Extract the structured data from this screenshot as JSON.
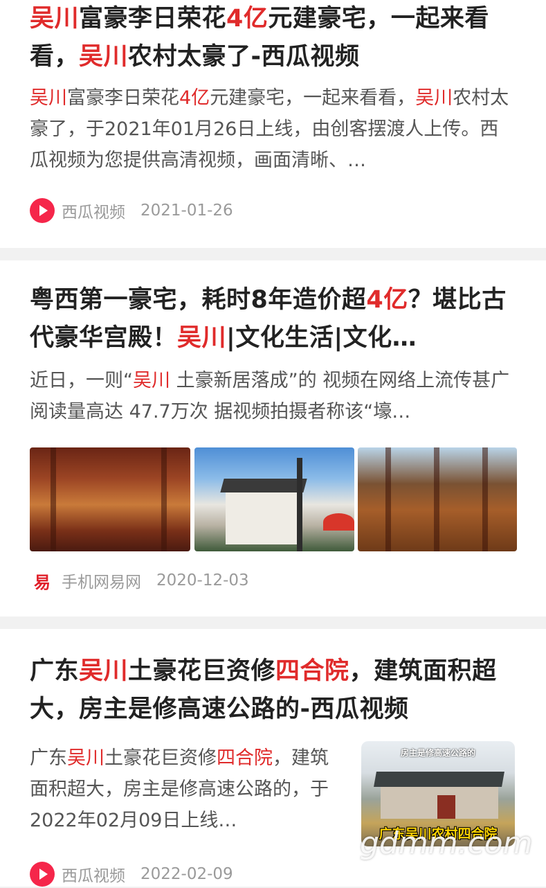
{
  "results": [
    {
      "title_segments": [
        {
          "text": "吴川",
          "hl": true
        },
        {
          "text": "富豪李日荣花",
          "hl": false
        },
        {
          "text": "4亿",
          "hl": true
        },
        {
          "text": "元建豪宅，一起来看看，",
          "hl": false
        },
        {
          "text": "吴川",
          "hl": true
        },
        {
          "text": "农村太豪了-西瓜视频",
          "hl": false
        }
      ],
      "desc_segments": [
        {
          "text": "吴川",
          "hl": true
        },
        {
          "text": "富豪李日荣花",
          "hl": false
        },
        {
          "text": "4亿",
          "hl": true
        },
        {
          "text": "元建豪宅，一起来看看，",
          "hl": false
        },
        {
          "text": "吴川",
          "hl": true
        },
        {
          "text": "农村太豪了，于2021年01月26日上线，由创客摆渡人上传。西瓜视频为您提供高清视频，画面清晰、…",
          "hl": false
        }
      ],
      "source": "西瓜视频",
      "source_icon": "xigua-video-icon",
      "date": "2021-01-26"
    },
    {
      "title_segments": [
        {
          "text": "粤西第一豪宅，耗时8年造价超",
          "hl": false
        },
        {
          "text": "4亿",
          "hl": true
        },
        {
          "text": "？堪比古代豪华宫殿！",
          "hl": false
        },
        {
          "text": "吴川",
          "hl": true
        },
        {
          "text": "|文化生活|文化…",
          "hl": false
        }
      ],
      "desc_segments": [
        {
          "text": "近日，一则“",
          "hl": false
        },
        {
          "text": "吴川",
          "hl": true
        },
        {
          "text": " 土豪新居落成”的 视频在网络上流传甚广 阅读量高达 47.7万次 据视频拍摄者称该“壕…",
          "hl": false
        }
      ],
      "source": "手机网易网",
      "source_icon": "netease-icon",
      "date": "2020-12-03"
    },
    {
      "title_segments": [
        {
          "text": "广东",
          "hl": false
        },
        {
          "text": "吴川",
          "hl": true
        },
        {
          "text": "土豪花巨资修",
          "hl": false
        },
        {
          "text": "四合院",
          "hl": true
        },
        {
          "text": "，建筑面积超大，房主是修高速公路的-西瓜视频",
          "hl": false
        }
      ],
      "desc_segments": [
        {
          "text": "广东",
          "hl": false
        },
        {
          "text": "吴川",
          "hl": true
        },
        {
          "text": "土豪花巨资修",
          "hl": false
        },
        {
          "text": "四合院",
          "hl": true
        },
        {
          "text": "，建筑面积超大，房主是修高速公路的，于2022年02月09日上线…",
          "hl": false
        }
      ],
      "thumb_caption_top": "房主是修高速公路的",
      "thumb_caption_bottom": "广东吴川农村四合院",
      "source": "西瓜视频",
      "source_icon": "xigua-video-icon",
      "date": "2022-02-09"
    }
  ],
  "watermark": "gdmm.com",
  "colors": {
    "highlight": "#e02b2b",
    "title": "#222222",
    "desc": "#555555",
    "meta": "#9a9a9a",
    "background": "#f1f1f1"
  }
}
